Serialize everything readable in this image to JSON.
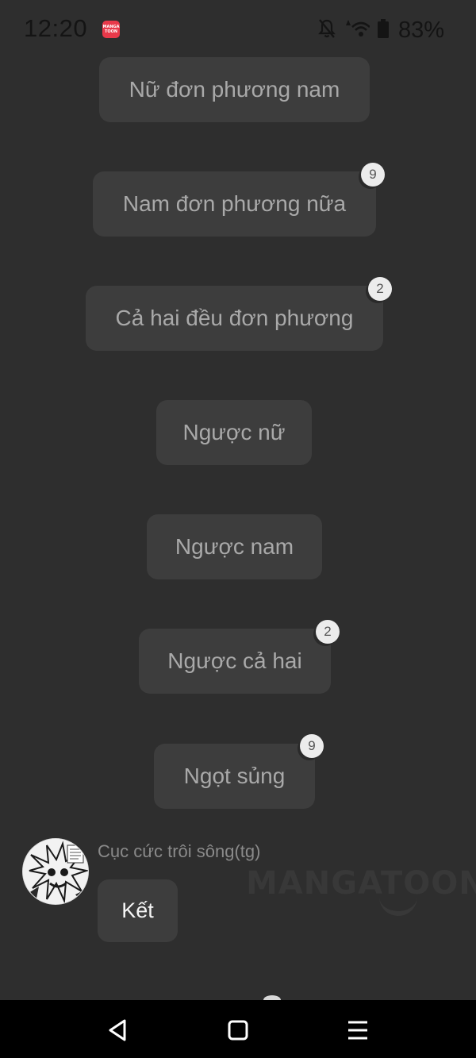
{
  "status_bar": {
    "time": "12:20",
    "app_icon_text": "MANGA TOON",
    "battery_percent": "83%",
    "icons": [
      "mute-icon",
      "wifi-icon",
      "battery-icon"
    ]
  },
  "options": [
    {
      "label": "Nữ đơn phương nam",
      "badge": ""
    },
    {
      "label": "Nam đơn phương nữa",
      "badge": "9"
    },
    {
      "label": "Cả hai đều đơn phương",
      "badge": "2"
    },
    {
      "label": "Ngược nữ",
      "badge": ""
    },
    {
      "label": "Ngược nam",
      "badge": ""
    },
    {
      "label": "Ngược cả hai",
      "badge": "2"
    },
    {
      "label": "Ngọt sủng",
      "badge": "9"
    }
  ],
  "author": {
    "name": "Cục cức trôi sông(tg)",
    "message": "Kết"
  },
  "watermark": "MANGATOON",
  "nav": {
    "buttons": [
      "back-icon",
      "home-icon",
      "menu-icon"
    ]
  },
  "colors": {
    "background": "#2e2e2e",
    "chip": "#3d3d3d",
    "chip_text": "#a9a9a9",
    "badge": "#ececec"
  }
}
